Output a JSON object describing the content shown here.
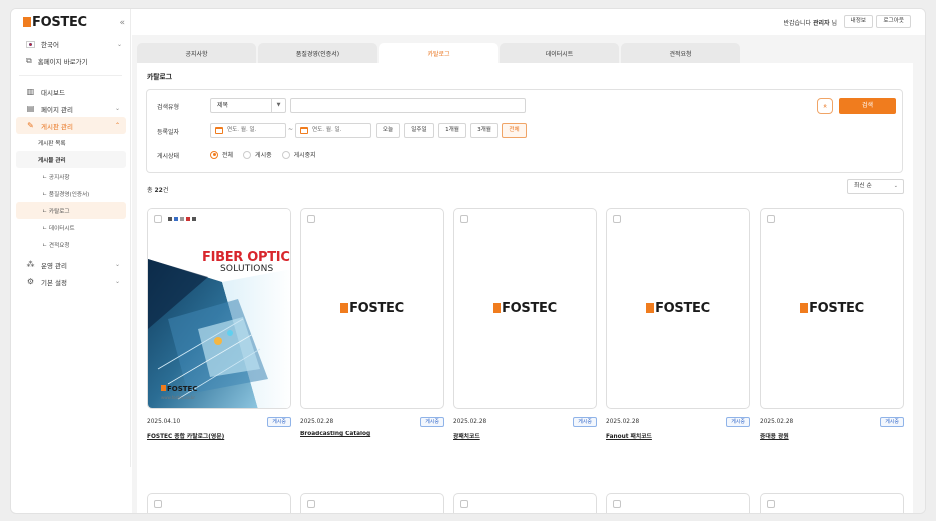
{
  "colors": {
    "accent": "#f07c1e",
    "badge": "#3569c9"
  },
  "brand": {
    "name": "FOSTEC",
    "collapse_icon": "«"
  },
  "sidebar": {
    "language": "한국어",
    "homepage_link": "홈페이지 바로가기",
    "menu": [
      {
        "label": "대시보드",
        "icon": "dashboard-icon"
      },
      {
        "label": "페이지 관리",
        "icon": "page-icon"
      },
      {
        "label": "게시판 관리",
        "icon": "pencil-icon"
      }
    ],
    "sub": {
      "board_list": "게시판 목록",
      "post_manage": "게시물 관리",
      "children": [
        "ㄴ 공지사항",
        "ㄴ 품질경영(인증서)",
        "ㄴ 카탈로그",
        "ㄴ 데이터시트",
        "ㄴ 견적요청"
      ]
    },
    "menu_bottom": [
      {
        "label": "운영 관리",
        "icon": "org-icon"
      },
      {
        "label": "기본 설정",
        "icon": "gear-icon"
      }
    ]
  },
  "topbar": {
    "greeting_prefix": "반갑습니다",
    "user": "관리자",
    "greeting_suffix": "님",
    "my_info": "내정보",
    "logout": "로그아웃"
  },
  "tabs": [
    "공지사항",
    "품질경영(인증서)",
    "카탈로그",
    "데이터시트",
    "견적요청"
  ],
  "panel": {
    "title": "카탈로그"
  },
  "search": {
    "type_label": "검색유형",
    "type_value": "제목",
    "date_label": "등록일자",
    "date_placeholder": "연도. 월. 일.",
    "date_sep": "~",
    "quick": [
      "오늘",
      "일주일",
      "1개월",
      "3개월",
      "전체"
    ],
    "status_label": "게시상태",
    "status_options": [
      "전체",
      "게시중",
      "게시중지"
    ],
    "search_button": "검색",
    "toggle_icon": "«"
  },
  "list": {
    "count_prefix": "총",
    "count_value": "22",
    "count_suffix": "건",
    "sort": "최신 순"
  },
  "cover": {
    "title_line1": "FIBER OPTIC",
    "title_line2": "SOLUTIONS",
    "brand": "FOSTEC",
    "url": "www.fostec.co.kr"
  },
  "cards": [
    {
      "date": "2025.04.10",
      "status": "게시중",
      "title": "FOSTEC 종합 카탈로그(영문)",
      "cover": true
    },
    {
      "date": "2025.02.28",
      "status": "게시중",
      "title": "Broadcasting Catalog",
      "cover": false
    },
    {
      "date": "2025.02.28",
      "status": "게시중",
      "title": "광패치코드",
      "cover": false
    },
    {
      "date": "2025.02.28",
      "status": "게시중",
      "title": "Fanout 패치코드",
      "cover": false
    },
    {
      "date": "2025.02.28",
      "status": "게시중",
      "title": "증대용 광원",
      "cover": false
    }
  ]
}
